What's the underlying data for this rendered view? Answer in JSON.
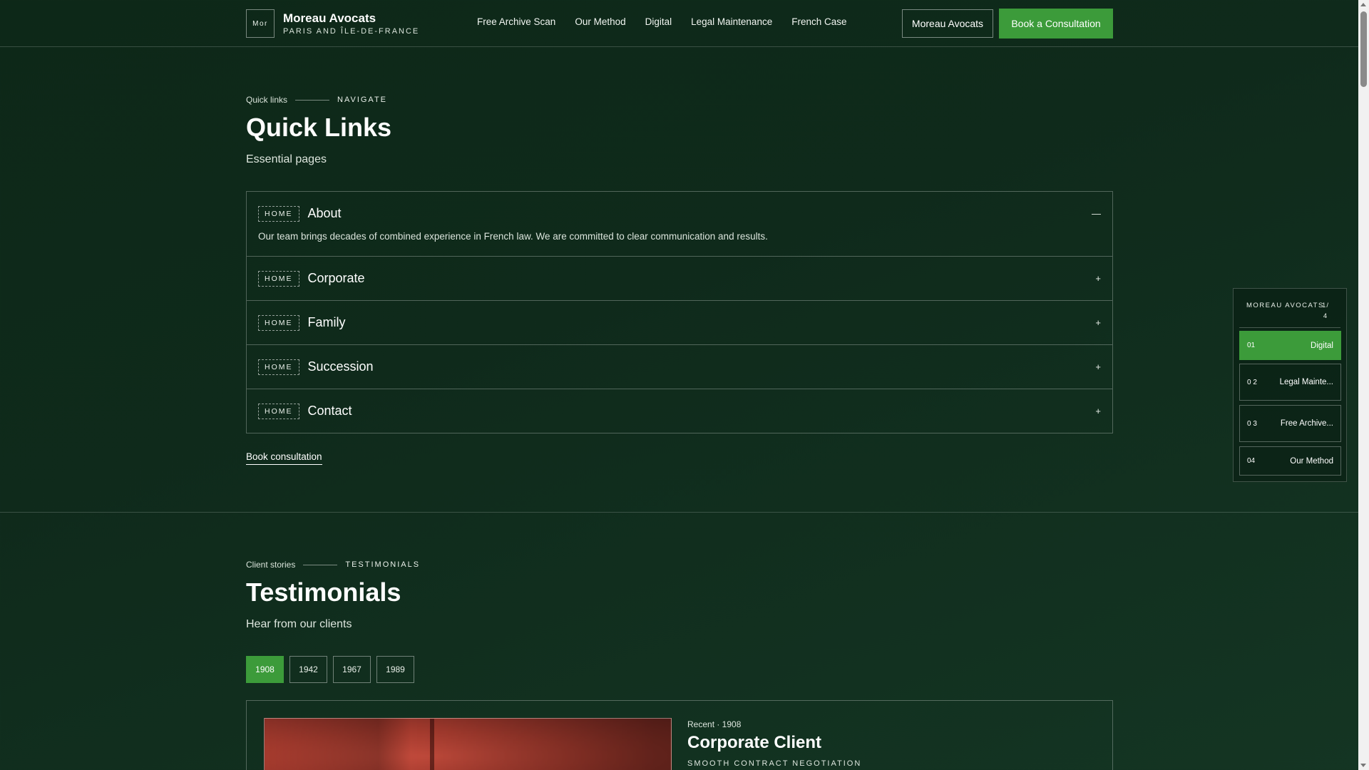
{
  "header": {
    "logo_text": "Mor",
    "brand_name": "Moreau Avocats",
    "brand_sub": "PARIS AND ÎLE-DE-FRANCE",
    "nav": [
      "Free Archive Scan",
      "Our Method",
      "Digital",
      "Legal Maintenance",
      "French Case"
    ],
    "outline_button": "Moreau Avocats",
    "primary_button": "Book a Consultation"
  },
  "quick_links": {
    "eyebrow_small": "Quick links",
    "eyebrow_cap": "NAVIGATE",
    "title": "Quick Links",
    "lead": "Essential pages",
    "items": [
      {
        "tag": "HOME",
        "title": "About",
        "toggle": "—",
        "body": "Our team brings decades of combined experience in French law. We are committed to clear communication and results."
      },
      {
        "tag": "HOME",
        "title": "Corporate",
        "toggle": "+"
      },
      {
        "tag": "HOME",
        "title": "Family",
        "toggle": "+"
      },
      {
        "tag": "HOME",
        "title": "Succession",
        "toggle": "+"
      },
      {
        "tag": "HOME",
        "title": "Contact",
        "toggle": "+"
      }
    ],
    "book_link": "Book consultation"
  },
  "testimonials": {
    "eyebrow_small": "Client stories",
    "eyebrow_cap": "TESTIMONIALS",
    "title": "Testimonials",
    "lead": "Hear from our clients",
    "years": [
      "1908",
      "1942",
      "1967",
      "1989"
    ],
    "active_year_index": 0,
    "card": {
      "meta": "Recent · 1908",
      "title": "Corporate Client",
      "sub": "SMOOTH CONTRACT NEGOTIATION"
    }
  },
  "side_widget": {
    "head": "MOREAU AVOCATS",
    "count": "1/ 4",
    "items": [
      {
        "num": "01",
        "label": "Digital"
      },
      {
        "num": "0 2",
        "label": "Legal Mainte..."
      },
      {
        "num": "0 3",
        "label": "Free Archive..."
      },
      {
        "num": "04",
        "label": "Our Method"
      }
    ]
  },
  "colors": {
    "background": "#0f2a1b",
    "accent": "#3c9b3a"
  }
}
